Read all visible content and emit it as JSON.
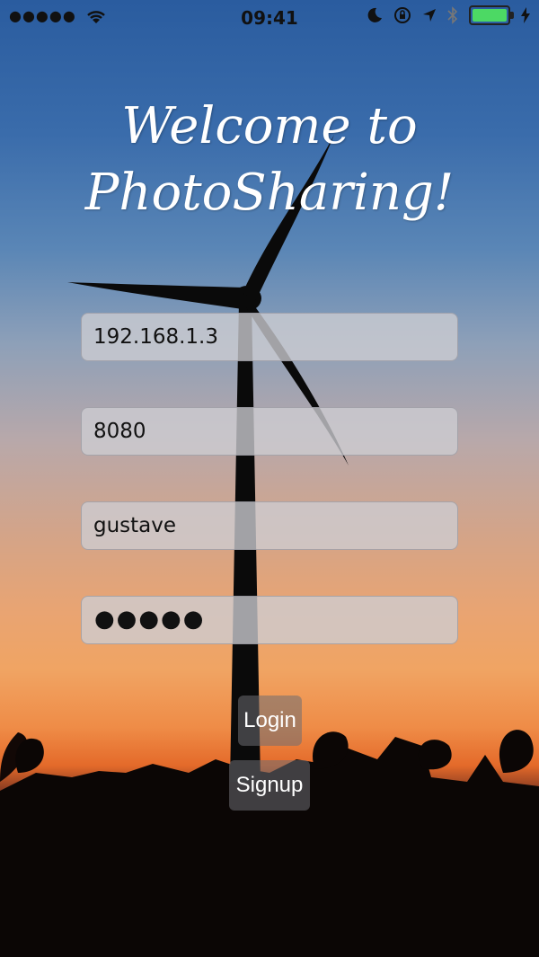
{
  "status_bar": {
    "signal_dots": "●●●●●",
    "time": "09:41",
    "icons": [
      "signal-dots-icon",
      "wifi-icon",
      "moon-icon",
      "orientation-lock-icon",
      "location-arrow-icon",
      "bluetooth-icon",
      "battery-icon",
      "charging-bolt-icon"
    ],
    "battery_color": "#4cd964"
  },
  "header": {
    "title_line1": "Welcome to",
    "title_line2": "PhotoSharing!"
  },
  "form": {
    "host": {
      "value": "192.168.1.3"
    },
    "port": {
      "value": "8080"
    },
    "username": {
      "value": "gustave"
    },
    "password": {
      "masked": "●●●●●"
    }
  },
  "buttons": {
    "login_label": "Login",
    "signup_label": "Signup"
  },
  "colors": {
    "sky_top": "#2a5c9f",
    "sunset": "#f0a463",
    "field_bg": "#cdcdd2"
  }
}
